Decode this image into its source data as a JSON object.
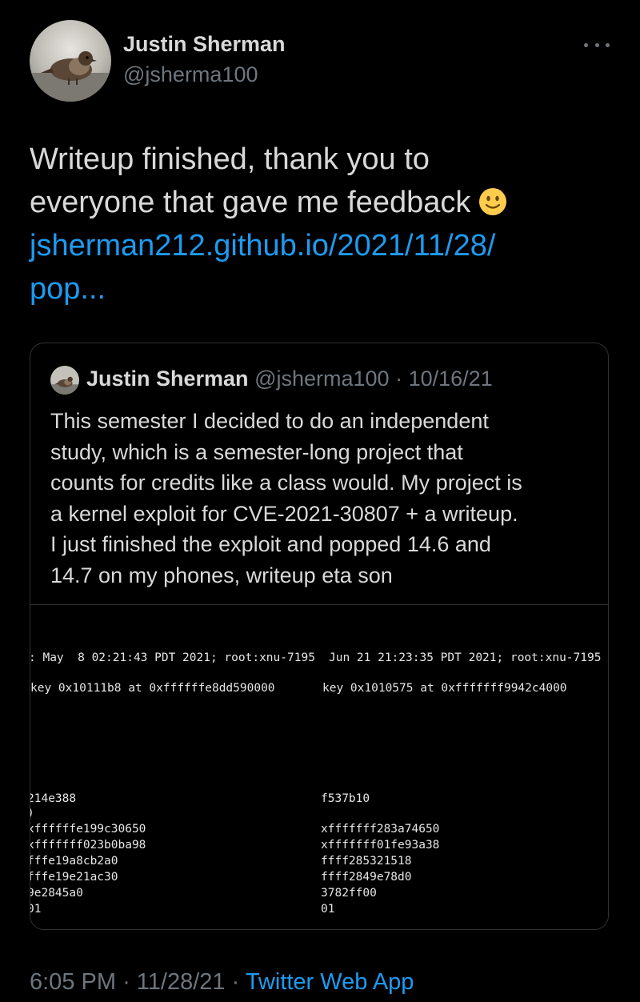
{
  "author": {
    "name": "Justin Sherman",
    "handle": "@jsherma100"
  },
  "more_icon": "more-horizontal-icon",
  "tweet": {
    "text_line1": "Writeup finished, thank you to",
    "text_line2": "everyone that gave me feedback",
    "emoji": "slightly-smiling-face-emoji",
    "link_line1": "jsherman212.github.io/2021/11/28/",
    "link_line2": "pop..."
  },
  "quote": {
    "name": "Justin Sherman",
    "handle": "@jsherma100",
    "dot": "·",
    "date": "10/16/21",
    "text_lines": [
      "This semester I decided to do an independent",
      "study, which is a semester-long project that",
      "counts for credits like a class would. My project is",
      "a kernel exploit for CVE-2021-30807 + a writeup.",
      "I just finished the exploit and popped 14.6 and",
      "14.7 on my phones, writeup eta son"
    ],
    "terminal_left": [
      ": May  8 02:21:43 PDT 2021; root:xnu-7195",
      "key 0x10111b8 at 0xffffffe8dd590000",
      "214e388",
      ")",
      "xffffffe199c30650",
      "xfffffff023b0ba98",
      "fffe19a8cb2a0",
      "fffe19e21ac30",
      "9e2845a0",
      "01"
    ],
    "terminal_right": [
      "Jun 21 21:23:35 PDT 2021; root:xnu-7195",
      "key 0x1010575 at 0xfffffff9942c4000",
      "f537b10",
      "xfffffff283a74650",
      "xfffffff01fe93a38",
      "ffff285321518",
      "ffff2849e78d0",
      "3782ff00",
      "01"
    ]
  },
  "footer": {
    "time": "6:05 PM",
    "sep1": "·",
    "date": "11/28/21",
    "sep2": "·",
    "source": "Twitter Web App"
  },
  "colors": {
    "background": "#000000",
    "text": "#d9d9d9",
    "secondary": "#6e767d",
    "link": "#1d9bf0",
    "border": "#2f3336"
  }
}
